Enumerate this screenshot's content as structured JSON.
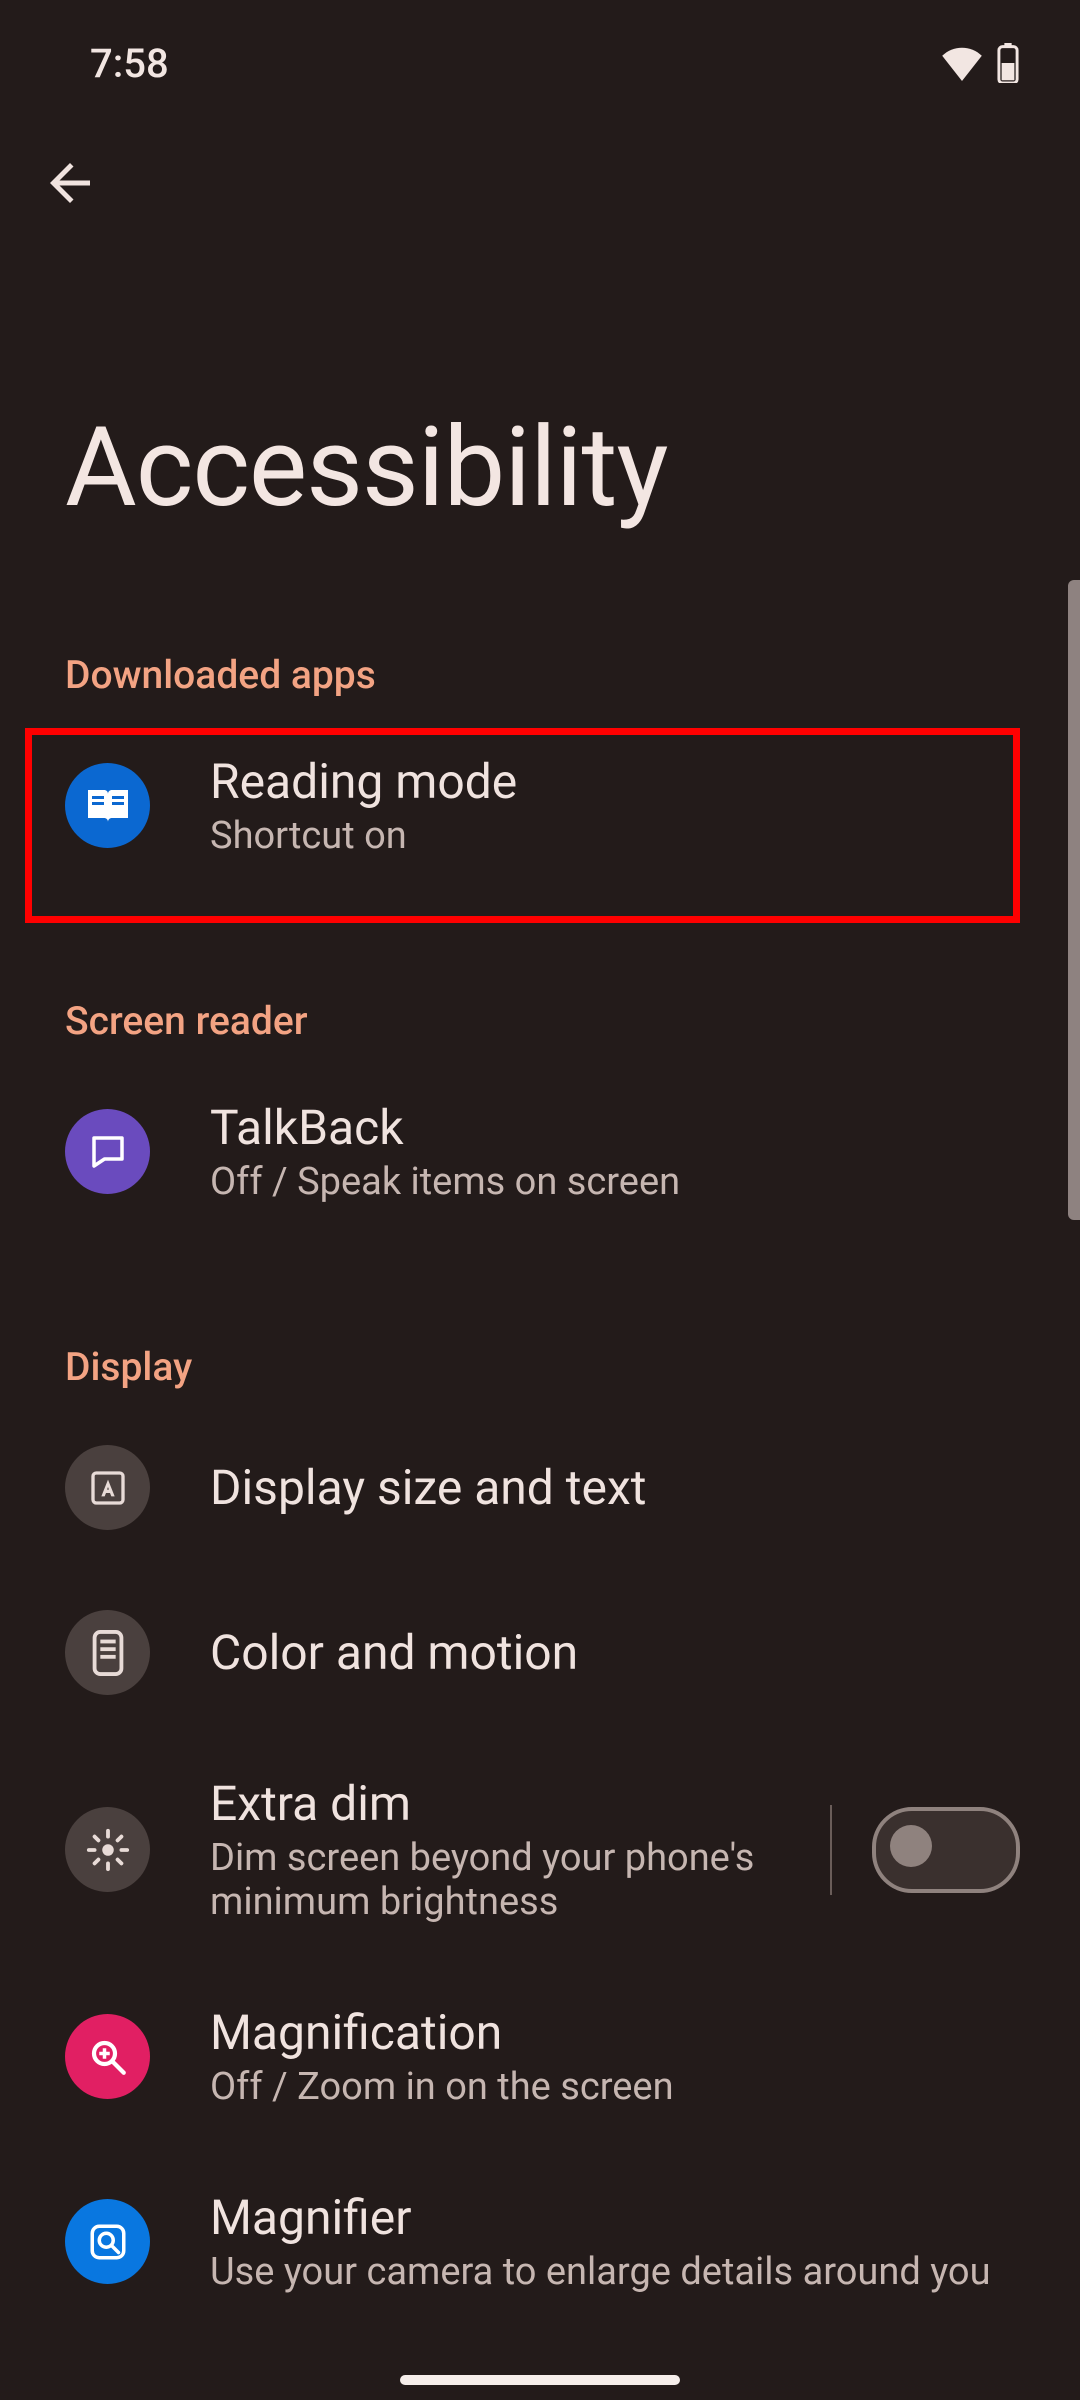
{
  "status": {
    "time": "7:58"
  },
  "header": {
    "title": "Accessibility"
  },
  "sections": {
    "downloaded": {
      "header": "Downloaded apps",
      "reading_mode": {
        "label": "Reading mode",
        "sub": "Shortcut on"
      }
    },
    "screen_reader": {
      "header": "Screen reader",
      "talkback": {
        "label": "TalkBack",
        "sub": "Off / Speak items on screen"
      }
    },
    "display": {
      "header": "Display",
      "size_text": {
        "label": "Display size and text"
      },
      "color_motion": {
        "label": "Color and motion"
      },
      "extra_dim": {
        "label": "Extra dim",
        "sub": "Dim screen beyond your phone's minimum brightness",
        "toggle": false
      },
      "magnification": {
        "label": "Magnification",
        "sub": "Off / Zoom in on the screen"
      },
      "magnifier": {
        "label": "Magnifier",
        "sub": "Use your camera to enlarge details around you"
      }
    }
  }
}
